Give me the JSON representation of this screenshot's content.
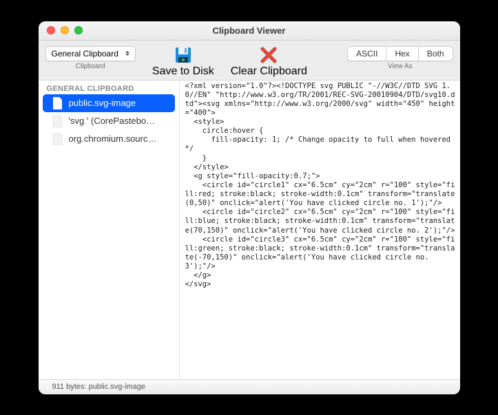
{
  "window": {
    "title": "Clipboard Viewer"
  },
  "toolbar": {
    "dropdown": {
      "value": "General Clipboard",
      "caption": "Clipboard"
    },
    "save": {
      "caption": "Save to Disk"
    },
    "clear": {
      "caption": "Clear Clipboard"
    },
    "viewas": {
      "caption": "View As",
      "segments": {
        "ascii": "ASCII",
        "hex": "Hex",
        "both": "Both"
      }
    }
  },
  "sidebar": {
    "section": "GENERAL CLIPBOARD",
    "items": [
      {
        "label": "public.svg-image"
      },
      {
        "label": "'svg ' (CorePastebo…"
      },
      {
        "label": "org.chromium.sourc…"
      }
    ]
  },
  "viewer": {
    "text": "<?xml version=\"1.0\"?><!DOCTYPE svg PUBLIC \"-//W3C//DTD SVG 1.0//EN\" \"http://www.w3.org/TR/2001/REC-SVG-20010904/DTD/svg10.dtd\"><svg xmlns=\"http://www.w3.org/2000/svg\" width=\"450\" height=\"400\">\n  <style>\n    circle:hover {\n      fill-opacity: 1; /* Change opacity to full when hovered */\n    }\n  </style>\n  <g style=\"fill-opacity:0.7;\">\n    <circle id=\"circle1\" cx=\"6.5cm\" cy=\"2cm\" r=\"100\" style=\"fill:red; stroke:black; stroke-width:0.1cm\" transform=\"translate(0,50)\" onclick=\"alert('You have clicked circle no. 1');\"/>\n    <circle id=\"circle2\" cx=\"6.5cm\" cy=\"2cm\" r=\"100\" style=\"fill:blue; stroke:black; stroke-width:0.1cm\" transform=\"translate(70,150)\" onclick=\"alert('You have clicked circle no. 2');\"/>\n    <circle id=\"circle3\" cx=\"6.5cm\" cy=\"2cm\" r=\"100\" style=\"fill:green; stroke:black; stroke-width:0.1cm\" transform=\"translate(-70,150)\" onclick=\"alert('You have clicked circle no. 3');\"/>\n  </g>\n</svg>"
  },
  "status": {
    "text": "911 bytes: public.svg-image"
  }
}
